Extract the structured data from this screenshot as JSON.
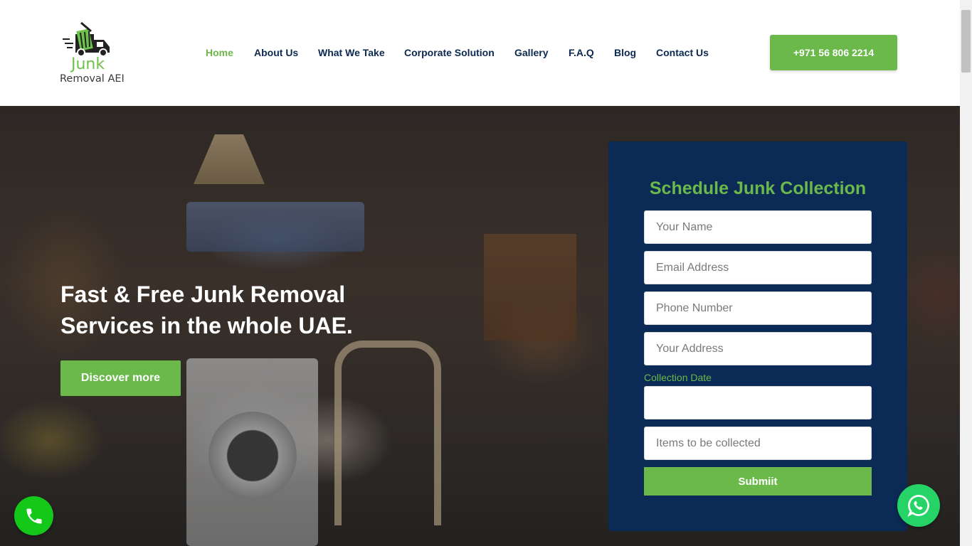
{
  "brand": {
    "logo_word": "Junk",
    "logo_sub": "Removal AEI"
  },
  "nav": {
    "items": [
      {
        "label": "Home",
        "active": true
      },
      {
        "label": "About Us",
        "active": false
      },
      {
        "label": "What We Take",
        "active": false
      },
      {
        "label": "Corporate Solution",
        "active": false
      },
      {
        "label": "Gallery",
        "active": false
      },
      {
        "label": "F.A.Q",
        "active": false
      },
      {
        "label": "Blog",
        "active": false
      },
      {
        "label": "Contact Us",
        "active": false
      }
    ],
    "phone_label": "+971 56 806 2214"
  },
  "hero": {
    "title_line1": "Fast & Free Junk Removal",
    "title_line2": "Services in the whole UAE.",
    "cta_label": "Discover more"
  },
  "form": {
    "title": "Schedule Junk Collection",
    "name_placeholder": "Your Name",
    "email_placeholder": "Email Address",
    "phone_placeholder": "Phone Number",
    "address_placeholder": "Your Address",
    "date_label": "Collection Date",
    "date_value": "",
    "items_placeholder": "Items to be collected",
    "submit_label": "Submiit"
  },
  "icons": {
    "logo": "junk-truck-icon",
    "call": "phone-icon",
    "whatsapp": "whatsapp-icon"
  },
  "colors": {
    "brand_green": "#6ab94a",
    "navy": "#0b2a55",
    "nav_text": "#0c2950",
    "call_green": "#14c81a",
    "whatsapp_green": "#25d366"
  }
}
